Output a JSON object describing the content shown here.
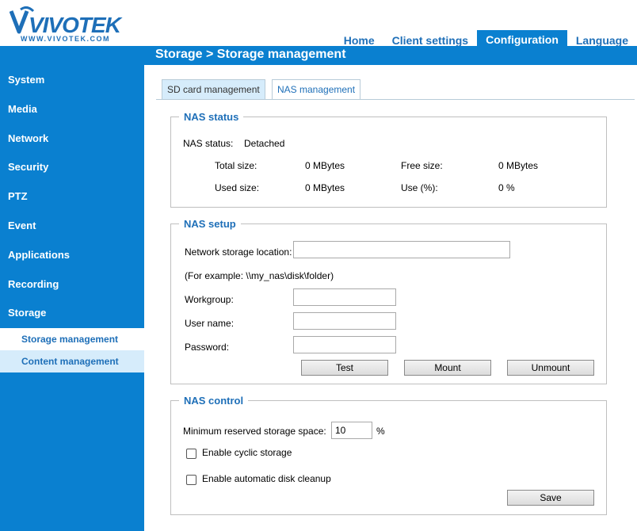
{
  "brand": {
    "logo_text": "VIVOTEK",
    "logo_sub": "WWW.VIVOTEK.COM"
  },
  "topnav": [
    {
      "label": "Home",
      "active": false
    },
    {
      "label": "Client settings",
      "active": false
    },
    {
      "label": "Configuration",
      "active": true
    },
    {
      "label": "Language",
      "active": false
    }
  ],
  "page_title": "Storage  > Storage management",
  "sidebar": {
    "items": [
      "System",
      "Media",
      "Network",
      "Security",
      "PTZ",
      "Event",
      "Applications",
      "Recording",
      "Storage"
    ],
    "sub_items": [
      {
        "label": "Storage management",
        "active": true
      },
      {
        "label": "Content management",
        "active": false
      }
    ]
  },
  "tabs": [
    {
      "label": "SD card management",
      "active": false
    },
    {
      "label": "NAS management",
      "active": true
    }
  ],
  "nas_status": {
    "legend": "NAS status",
    "status_label": "NAS status:",
    "status_value": "Detached",
    "total_size_label": "Total size:",
    "total_size_value": "0 MBytes",
    "free_size_label": "Free size:",
    "free_size_value": "0 MBytes",
    "used_size_label": "Used size:",
    "used_size_value": "0 MBytes",
    "use_pct_label": "Use (%):",
    "use_pct_value": "0 %"
  },
  "nas_setup": {
    "legend": "NAS setup",
    "location_label": "Network storage location:",
    "location_value": "",
    "example": "(For example: \\\\my_nas\\disk\\folder)",
    "workgroup_label": "Workgroup:",
    "workgroup_value": "",
    "username_label": "User name:",
    "username_value": "",
    "password_label": "Password:",
    "password_value": "",
    "test_button": "Test",
    "mount_button": "Mount",
    "unmount_button": "Unmount"
  },
  "nas_control": {
    "legend": "NAS control",
    "reserved_label": "Minimum reserved storage space:",
    "reserved_value": "10",
    "reserved_unit": "%",
    "cyclic_label": "Enable cyclic storage",
    "cyclic_checked": false,
    "cleanup_label": "Enable automatic disk cleanup",
    "cleanup_checked": false,
    "save_button": "Save"
  },
  "colors": {
    "accent": "#0a80d0",
    "link": "#1e6fb8",
    "sub_bg": "#d6ecfb"
  }
}
